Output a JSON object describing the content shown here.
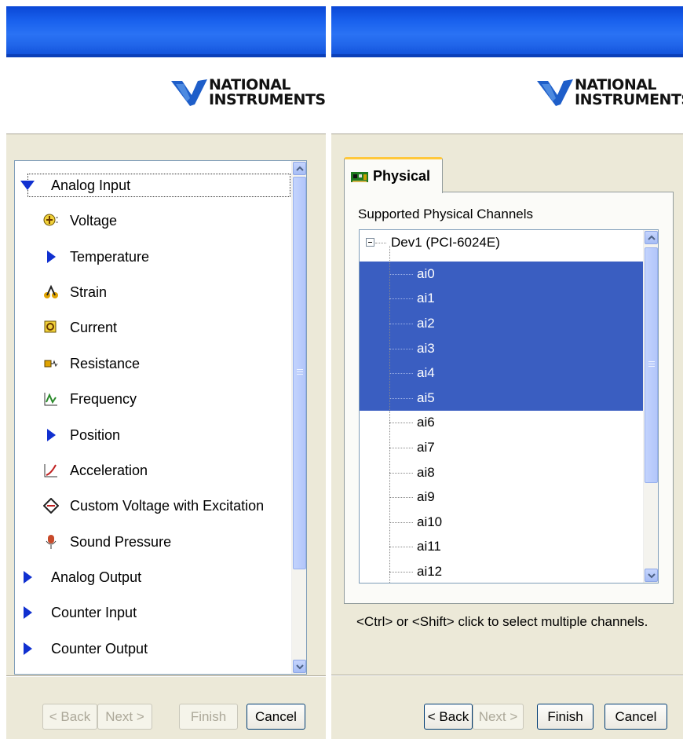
{
  "brand": {
    "line1": "NATIONAL",
    "line2": "INSTRUMENTS",
    "tm": "™"
  },
  "left": {
    "tree": [
      {
        "label": "Analog Input",
        "level": 0,
        "expanded": true,
        "icon": "expanded-triangle-icon"
      },
      {
        "label": "Voltage",
        "level": 1,
        "icon": "voltage-icon"
      },
      {
        "label": "Temperature",
        "level": 1,
        "icon": "collapsed-triangle-icon"
      },
      {
        "label": "Strain",
        "level": 1,
        "icon": "strain-icon"
      },
      {
        "label": "Current",
        "level": 1,
        "icon": "current-icon"
      },
      {
        "label": "Resistance",
        "level": 1,
        "icon": "resistance-icon"
      },
      {
        "label": "Frequency",
        "level": 1,
        "icon": "frequency-icon"
      },
      {
        "label": "Position",
        "level": 1,
        "icon": "collapsed-triangle-icon"
      },
      {
        "label": "Acceleration",
        "level": 1,
        "icon": "acceleration-icon"
      },
      {
        "label": "Custom Voltage with Excitation",
        "level": 1,
        "icon": "custom-voltage-icon"
      },
      {
        "label": "Sound Pressure",
        "level": 1,
        "icon": "microphone-icon"
      },
      {
        "label": "Analog Output",
        "level": 0,
        "icon": "collapsed-triangle-icon"
      },
      {
        "label": "Counter Input",
        "level": 0,
        "icon": "collapsed-triangle-icon"
      },
      {
        "label": "Counter Output",
        "level": 0,
        "icon": "collapsed-triangle-icon"
      }
    ],
    "buttons": {
      "back": "< Back",
      "next": "Next >",
      "finish": "Finish",
      "cancel": "Cancel"
    }
  },
  "right": {
    "tab_label": "Physical",
    "supported_label": "Supported Physical Channels",
    "device": "Dev1  (PCI-6024E)",
    "channels": [
      "ai0",
      "ai1",
      "ai2",
      "ai3",
      "ai4",
      "ai5",
      "ai6",
      "ai7",
      "ai8",
      "ai9",
      "ai10",
      "ai11",
      "ai12"
    ],
    "selected_channels": [
      "ai0",
      "ai1",
      "ai2",
      "ai3",
      "ai4",
      "ai5"
    ],
    "hint": "<Ctrl> or <Shift> click to select multiple channels.",
    "buttons": {
      "back": "< Back",
      "next": "Next >",
      "finish": "Finish",
      "cancel": "Cancel"
    }
  },
  "colors": {
    "selection": "#3a5ec1",
    "tree_arrow": "#1030d0",
    "titlebar": "#1a62ee"
  }
}
